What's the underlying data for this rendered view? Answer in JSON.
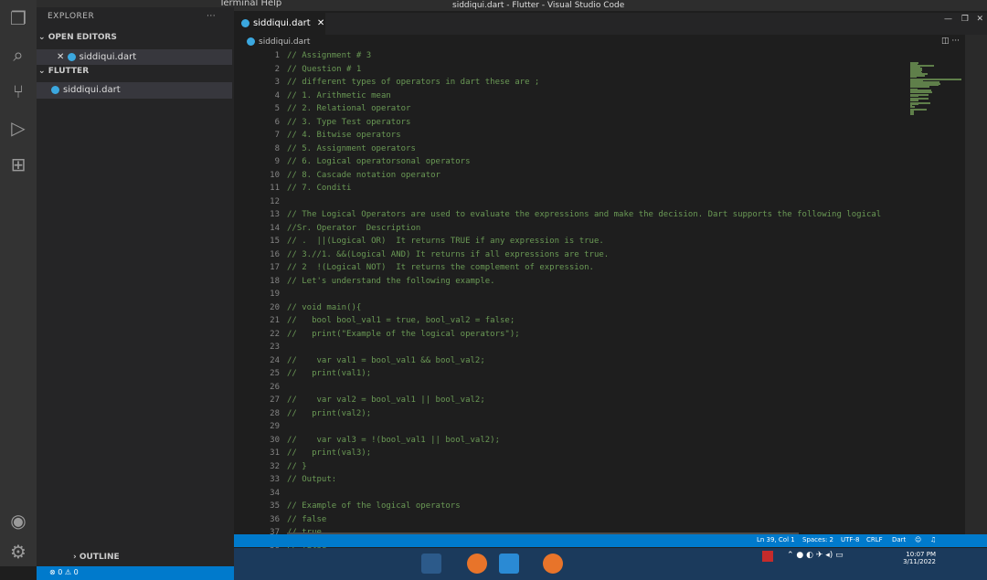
{
  "window": {
    "menu_fragment": "Terminal  Help",
    "title": "siddiqui.dart - Flutter - Visual Studio Code"
  },
  "sidebar": {
    "header": "EXPLORER",
    "more": "···",
    "open_editors_label": "OPEN EDITORS",
    "open_file": "siddiqui.dart",
    "project_label": "FLUTTER",
    "project_file": "siddiqui.dart",
    "outline_label": "OUTLINE"
  },
  "tabs": [
    {
      "label": "siddiqui.dart"
    }
  ],
  "breadcrumb": "siddiqui.dart",
  "editor": {
    "lines": [
      "// Assignment # 3",
      "// Question # 1",
      "// different types of operators in dart these are ;",
      "// 1. Arithmetic mean",
      "// 2. Relational operator",
      "// 3. Type Test operators",
      "// 4. Bitwise operators",
      "// 5. Assignment operators",
      "// 6. Logical operatorsonal operators",
      "// 8. Cascade notation operator",
      "// 7. Conditi",
      "",
      "// The Logical Operators are used to evaluate the expressions and make the decision. Dart supports the following logical",
      "//Sr. Operator  Description",
      "// .  ||(Logical OR)  It returns TRUE if any expression is true.",
      "// 3.//1. &&(Logical AND) It returns if all expressions are true.",
      "// 2  !(Logical NOT)  It returns the complement of expression.",
      "// Let's understand the following example.",
      "",
      "// void main(){",
      "//   bool bool_val1 = true, bool_val2 = false;",
      "//   print(\"Example of the logical operators\");",
      "",
      "//    var val1 = bool_val1 && bool_val2;",
      "//   print(val1);",
      "",
      "//    var val2 = bool_val1 || bool_val2;",
      "//   print(val2);",
      "",
      "//    var val3 = !(bool_val1 || bool_val2);",
      "//   print(val3);",
      "// }",
      "// Output:",
      "",
      "// Example of the logical operators",
      "// false",
      "// true",
      "// false",
      ""
    ]
  },
  "statusbar": {
    "errors": "⊗ 0 ⚠ 0",
    "position": "Ln 39, Col 1",
    "spaces": "Spaces: 2",
    "encoding": "UTF-8",
    "eol": "CRLF",
    "language": "Dart"
  },
  "taskbar": {
    "time": "10:07 PM",
    "date": "3/11/2022"
  }
}
